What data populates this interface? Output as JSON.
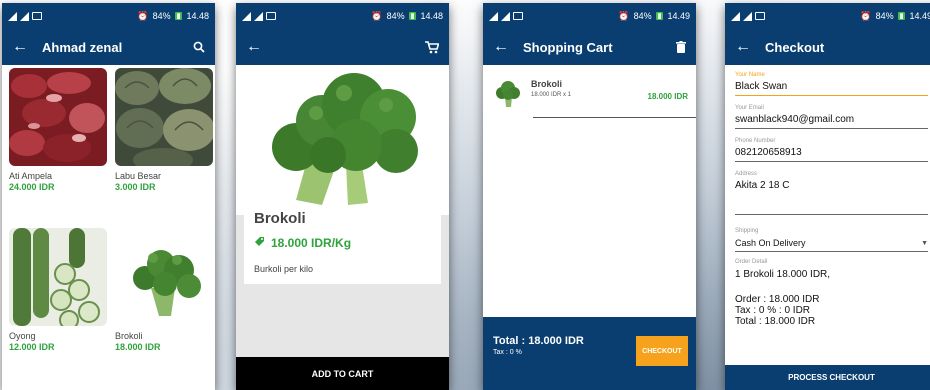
{
  "status": {
    "icons": [
      "alarm-icon",
      "signal-icon",
      "battery-icon"
    ],
    "screens": [
      {
        "battery": "84%",
        "time": "14.48"
      },
      {
        "battery": "84%",
        "time": "14.48"
      },
      {
        "battery": "84%",
        "time": "14.49"
      },
      {
        "battery": "84%",
        "time": "14.49"
      }
    ]
  },
  "colors": {
    "primary": "#0b3e70",
    "price_green": "#2ea33c",
    "accent_orange": "#f7a21c"
  },
  "catalog": {
    "title": "Ahmad zenal",
    "action_icon": "search-icon",
    "products": [
      {
        "name": "Ati Ampela",
        "price": "24.000 IDR",
        "image": "chicken-liver"
      },
      {
        "name": "Labu Besar",
        "price": "3.000 IDR",
        "image": "pumpkin"
      },
      {
        "name": "Oyong",
        "price": "12.000 IDR",
        "image": "sponge-gourd"
      },
      {
        "name": "Brokoli",
        "price": "18.000 IDR",
        "image": "broccoli"
      }
    ]
  },
  "detail": {
    "action_icon": "cart-icon",
    "name": "Brokoli",
    "price": "18.000 IDR/Kg",
    "description": "Burkoli per kilo",
    "add_to_cart_label": "ADD TO CART"
  },
  "cart": {
    "title": "Shopping Cart",
    "action_icon": "trash-icon",
    "items": [
      {
        "name": "Brokoli",
        "qty_line": "18.000 IDR x 1",
        "line_total": "18.000 IDR"
      }
    ],
    "total": "Total : 18.000 IDR",
    "tax": "Tax : 0 %",
    "checkout_label": "CHECKOUT"
  },
  "checkout": {
    "title": "Checkout",
    "fields": {
      "name_label": "Your Name",
      "name_value": "Black Swan",
      "email_label": "Your Email",
      "email_value": "swanblack940@gmail.com",
      "phone_label": "Phone Number",
      "phone_value": "082120658913",
      "address_label": "Address",
      "address_value": "Akita 2 18 C"
    },
    "shipping_label": "Shipping",
    "shipping_value": "Cash On Delivery",
    "order_detail_label": "Order Detail",
    "order_line": "1 Brokoli 18.000 IDR,",
    "order_total": "Order : 18.000 IDR",
    "tax_line": "Tax : 0 % : 0 IDR",
    "grand_total": "Total : 18.000 IDR",
    "process_label": "PROCESS CHECKOUT"
  }
}
